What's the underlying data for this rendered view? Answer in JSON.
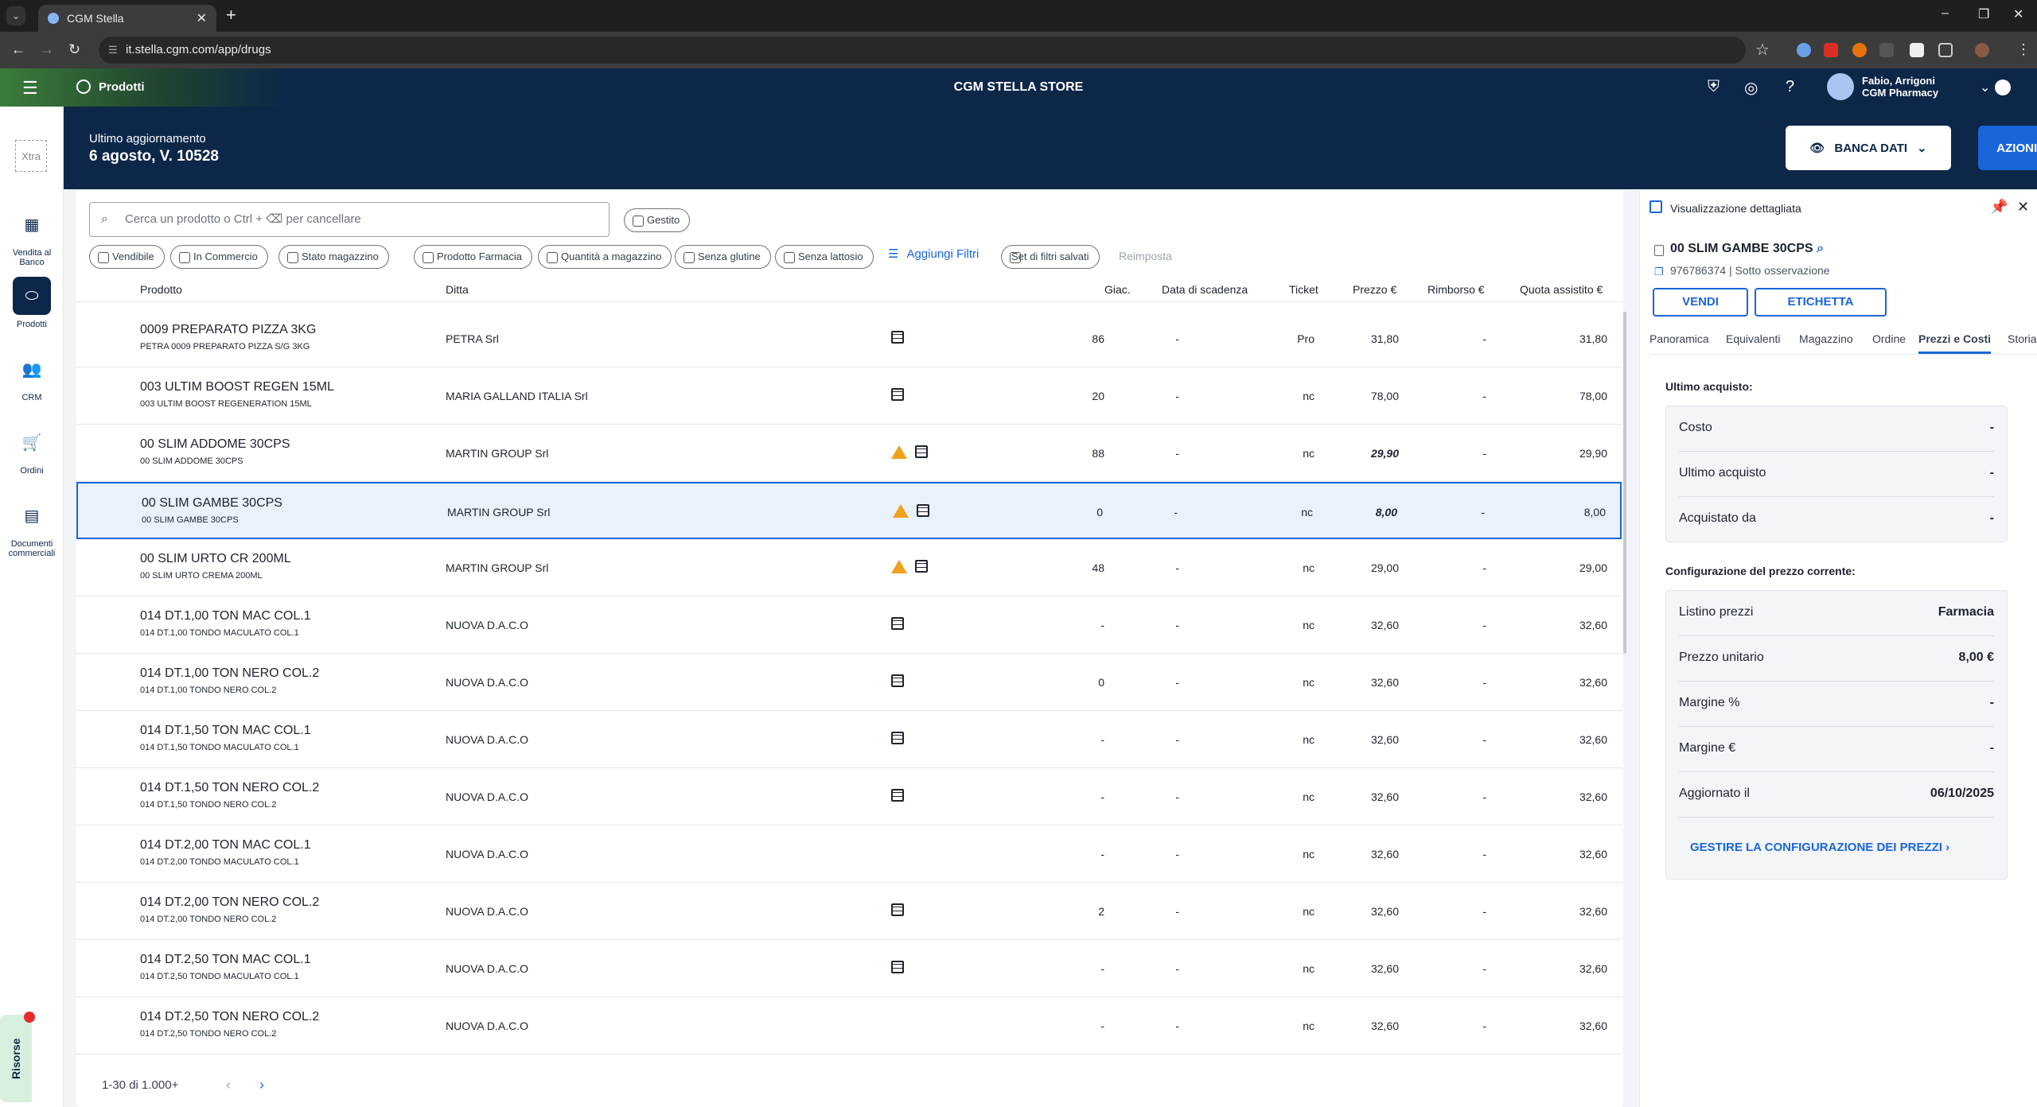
{
  "browser": {
    "tab_title": "CGM Stella",
    "url": "it.stella.cgm.com/app/drugs"
  },
  "app": {
    "section": "Prodotti",
    "store_title": "CGM STELLA STORE",
    "user_name": "Fabio, Arrigoni",
    "user_org": "CGM Pharmacy",
    "help": "?"
  },
  "hero": {
    "label": "Ultimo aggiornamento",
    "version": "6 agosto, V. 10528",
    "banca_dati": "BANCA DATI",
    "azioni": "AZIONI"
  },
  "sidebar": {
    "xtra": "Xtra",
    "items": [
      {
        "label": "Vendita al Banco",
        "icon": "calculator-icon"
      },
      {
        "label": "Prodotti",
        "icon": "pill-icon"
      },
      {
        "label": "CRM",
        "icon": "people-icon"
      },
      {
        "label": "Ordini",
        "icon": "cart-icon"
      },
      {
        "label": "Documenti commerciali",
        "icon": "document-icon"
      }
    ],
    "risorse": "Risorse"
  },
  "search": {
    "placeholder": "Cerca un prodotto o Ctrl + ⌫ per cancellare",
    "gestito": "Gestito"
  },
  "filters": [
    "Vendibile",
    "In Commercio",
    "Stato magazzino",
    "Prodotto Farmacia",
    "Quantità a magazzino",
    "Senza glutine",
    "Senza lattosio"
  ],
  "add_filters": "Aggiungi Filtri",
  "saved_filters": "Set di filtri salvati",
  "reset": "Reimposta",
  "columns": {
    "prodotto": "Prodotto",
    "ditta": "Ditta",
    "giac": "Giac.",
    "scadenza": "Data di scadenza",
    "ticket": "Ticket",
    "prezzo": "Prezzo €",
    "rimborso": "Rimborso €",
    "quota": "Quota assistito €"
  },
  "rows": [
    {
      "name": "0009 PREPARATO PIZZA 3KG",
      "desc": "PETRA 0009 PREPARATO PIZZA S/G 3KG",
      "ditta": "PETRA Srl",
      "giac": "86",
      "scad": "-",
      "ticket": "Pro",
      "prezzo": "31,80",
      "rimb": "-",
      "quota": "31,80",
      "warn": false,
      "doc": true
    },
    {
      "name": "003 ULTIM BOOST REGEN 15ML",
      "desc": "003 ULTIM BOOST REGENERATION 15ML",
      "ditta": "MARIA GALLAND ITALIA Srl",
      "giac": "20",
      "scad": "-",
      "ticket": "nc",
      "prezzo": "78,00",
      "rimb": "-",
      "quota": "78,00",
      "warn": false,
      "doc": true
    },
    {
      "name": "00 SLIM ADDOME 30CPS",
      "desc": "00 SLIM ADDOME 30CPS",
      "ditta": "MARTIN GROUP Srl",
      "giac": "88",
      "scad": "-",
      "ticket": "nc",
      "prezzo": "29,90",
      "rimb": "-",
      "quota": "29,90",
      "warn": true,
      "doc": true
    },
    {
      "name": "00 SLIM GAMBE 30CPS",
      "desc": "00 SLIM GAMBE 30CPS",
      "ditta": "MARTIN GROUP Srl",
      "giac": "0",
      "scad": "-",
      "ticket": "nc",
      "prezzo": "8,00",
      "rimb": "-",
      "quota": "8,00",
      "warn": true,
      "doc": true
    },
    {
      "name": "00 SLIM URTO CR 200ML",
      "desc": "00 SLIM URTO CREMA 200ML",
      "ditta": "MARTIN GROUP Srl",
      "giac": "48",
      "scad": "-",
      "ticket": "nc",
      "prezzo": "29,00",
      "rimb": "-",
      "quota": "29,00",
      "warn": true,
      "doc": true
    },
    {
      "name": "014 DT.1,00 TON MAC COL.1",
      "desc": "014 DT.1,00 TONDO MACULATO COL.1",
      "ditta": "NUOVA D.A.C.O",
      "giac": "-",
      "scad": "-",
      "ticket": "nc",
      "prezzo": "32,60",
      "rimb": "-",
      "quota": "32,60",
      "warn": false,
      "doc": true
    },
    {
      "name": "014 DT.1,00 TON NERO COL.2",
      "desc": "014 DT.1,00 TONDO NERO COL.2",
      "ditta": "NUOVA D.A.C.O",
      "giac": "0",
      "scad": "-",
      "ticket": "nc",
      "prezzo": "32,60",
      "rimb": "-",
      "quota": "32,60",
      "warn": false,
      "doc": true
    },
    {
      "name": "014 DT.1,50 TON MAC COL.1",
      "desc": "014 DT.1,50 TONDO MACULATO COL.1",
      "ditta": "NUOVA D.A.C.O",
      "giac": "-",
      "scad": "-",
      "ticket": "nc",
      "prezzo": "32,60",
      "rimb": "-",
      "quota": "32,60",
      "warn": false,
      "doc": true
    },
    {
      "name": "014 DT.1,50 TON NERO COL.2",
      "desc": "014 DT.1,50 TONDO NERO COL.2",
      "ditta": "NUOVA D.A.C.O",
      "giac": "-",
      "scad": "-",
      "ticket": "nc",
      "prezzo": "32,60",
      "rimb": "-",
      "quota": "32,60",
      "warn": false,
      "doc": true
    },
    {
      "name": "014 DT.2,00 TON MAC COL.1",
      "desc": "014 DT.2,00 TONDO MACULATO COL.1",
      "ditta": "NUOVA D.A.C.O",
      "giac": "-",
      "scad": "-",
      "ticket": "nc",
      "prezzo": "32,60",
      "rimb": "-",
      "quota": "32,60",
      "warn": false,
      "doc": false
    },
    {
      "name": "014 DT.2,00 TON NERO COL.2",
      "desc": "014 DT.2,00 TONDO NERO COL.2",
      "ditta": "NUOVA D.A.C.O",
      "giac": "2",
      "scad": "-",
      "ticket": "nc",
      "prezzo": "32,60",
      "rimb": "-",
      "quota": "32,60",
      "warn": false,
      "doc": true
    },
    {
      "name": "014 DT.2,50 TON MAC COL.1",
      "desc": "014 DT.2,50 TONDO MACULATO COL.1",
      "ditta": "NUOVA D.A.C.O",
      "giac": "-",
      "scad": "-",
      "ticket": "nc",
      "prezzo": "32,60",
      "rimb": "-",
      "quota": "32,60",
      "warn": false,
      "doc": true
    },
    {
      "name": "014 DT.2,50 TON NERO COL.2",
      "desc": "014 DT.2,50 TONDO NERO COL.2",
      "ditta": "NUOVA D.A.C.O",
      "giac": "-",
      "scad": "-",
      "ticket": "nc",
      "prezzo": "32,60",
      "rimb": "-",
      "quota": "32,60",
      "warn": false,
      "doc": false
    }
  ],
  "pagination": "1-30 di 1.000+",
  "panel": {
    "title": "Visualizzazione dettagliata",
    "product": "00 SLIM GAMBE 30CPS",
    "code": "976786374",
    "status": "Sotto osservazione",
    "vendi": "VENDI",
    "etichetta": "ETICHETTA",
    "tabs": [
      "Panoramica",
      "Equivalenti",
      "Magazzino",
      "Ordine",
      "Prezzi e Costi",
      "Storia"
    ],
    "ultimo_title": "Ultimo acquisto:",
    "ultimo": [
      {
        "k": "Costo",
        "v": "-"
      },
      {
        "k": "Ultimo acquisto",
        "v": "-"
      },
      {
        "k": "Acquistato da",
        "v": "-"
      }
    ],
    "config_title": "Configurazione del prezzo corrente:",
    "config": [
      {
        "k": "Listino prezzi",
        "v": "Farmacia"
      },
      {
        "k": "Prezzo unitario",
        "v": "8,00 €"
      },
      {
        "k": "Margine %",
        "v": "-"
      },
      {
        "k": "Margine €",
        "v": "-"
      },
      {
        "k": "Aggiornato il",
        "v": "06/10/2025"
      }
    ],
    "link": "GESTIRE LA CONFIGURAZIONE DEI PREZZI"
  }
}
